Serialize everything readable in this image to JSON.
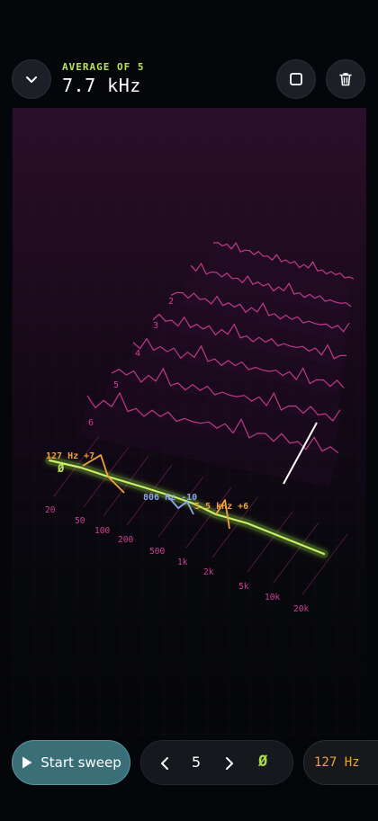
{
  "header": {
    "label": "AVERAGE OF 5",
    "value": "7.7 kHz"
  },
  "frequency_axis": [
    "20",
    "50",
    "100",
    "200",
    "500",
    "1k",
    "2k",
    "5k",
    "10k",
    "20k"
  ],
  "row_labels": [
    "2",
    "3",
    "4",
    "5",
    "6"
  ],
  "annotations": {
    "low": "127 Hz +7",
    "mid": "806 Hz -10",
    "high": "5.5 kHz +6",
    "phase": "Ø"
  },
  "toolbar": {
    "start_label": "Start sweep",
    "count": "5",
    "phase_symbol": "Ø",
    "freq_chip": "127 Hz"
  },
  "icons": {
    "collapse": "chevron-down-icon",
    "stop": "square-icon",
    "trash": "trash-icon",
    "play": "play-icon",
    "prev": "chevron-left-icon",
    "next": "chevron-right-icon"
  },
  "colors": {
    "accent": "#b9e35a",
    "magenta": "#d13f93",
    "orange": "#f2a03a",
    "blue": "#8aa8e8",
    "start_button": "#3a6f78"
  }
}
